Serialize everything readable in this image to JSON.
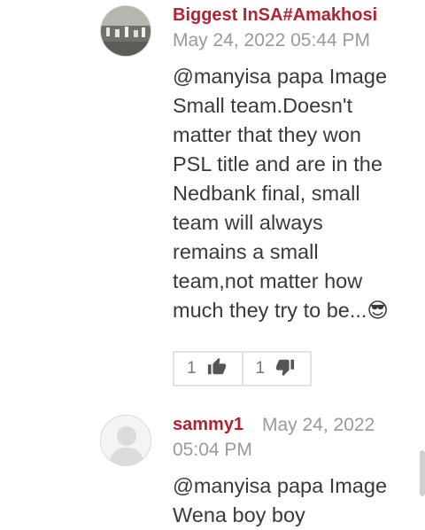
{
  "comments": [
    {
      "author": "Biggest InSA#Amakhosi",
      "date": "May 24, 2022 05:44 PM",
      "lines": [
        "@manyisa papa Image",
        "Small team.Doesn't",
        "matter that they won",
        "PSL title and are in the",
        "Nedbank final, small",
        "team will always",
        "remains a small",
        "team,not matter how",
        "much they try to be...😎"
      ],
      "likes": "1",
      "dislikes": "1"
    },
    {
      "author": "sammy1",
      "date_line1": "May 24, 2022",
      "date_line2": "05:04 PM",
      "lines": [
        "@manyisa papa Image",
        "Wena boy boy"
      ]
    }
  ],
  "icons": {
    "like": "thumbs-up-icon",
    "dislike": "thumbs-down-icon"
  },
  "colors": {
    "author": "#b52230",
    "date": "#9a9a9a",
    "text": "#3a3a3a"
  }
}
